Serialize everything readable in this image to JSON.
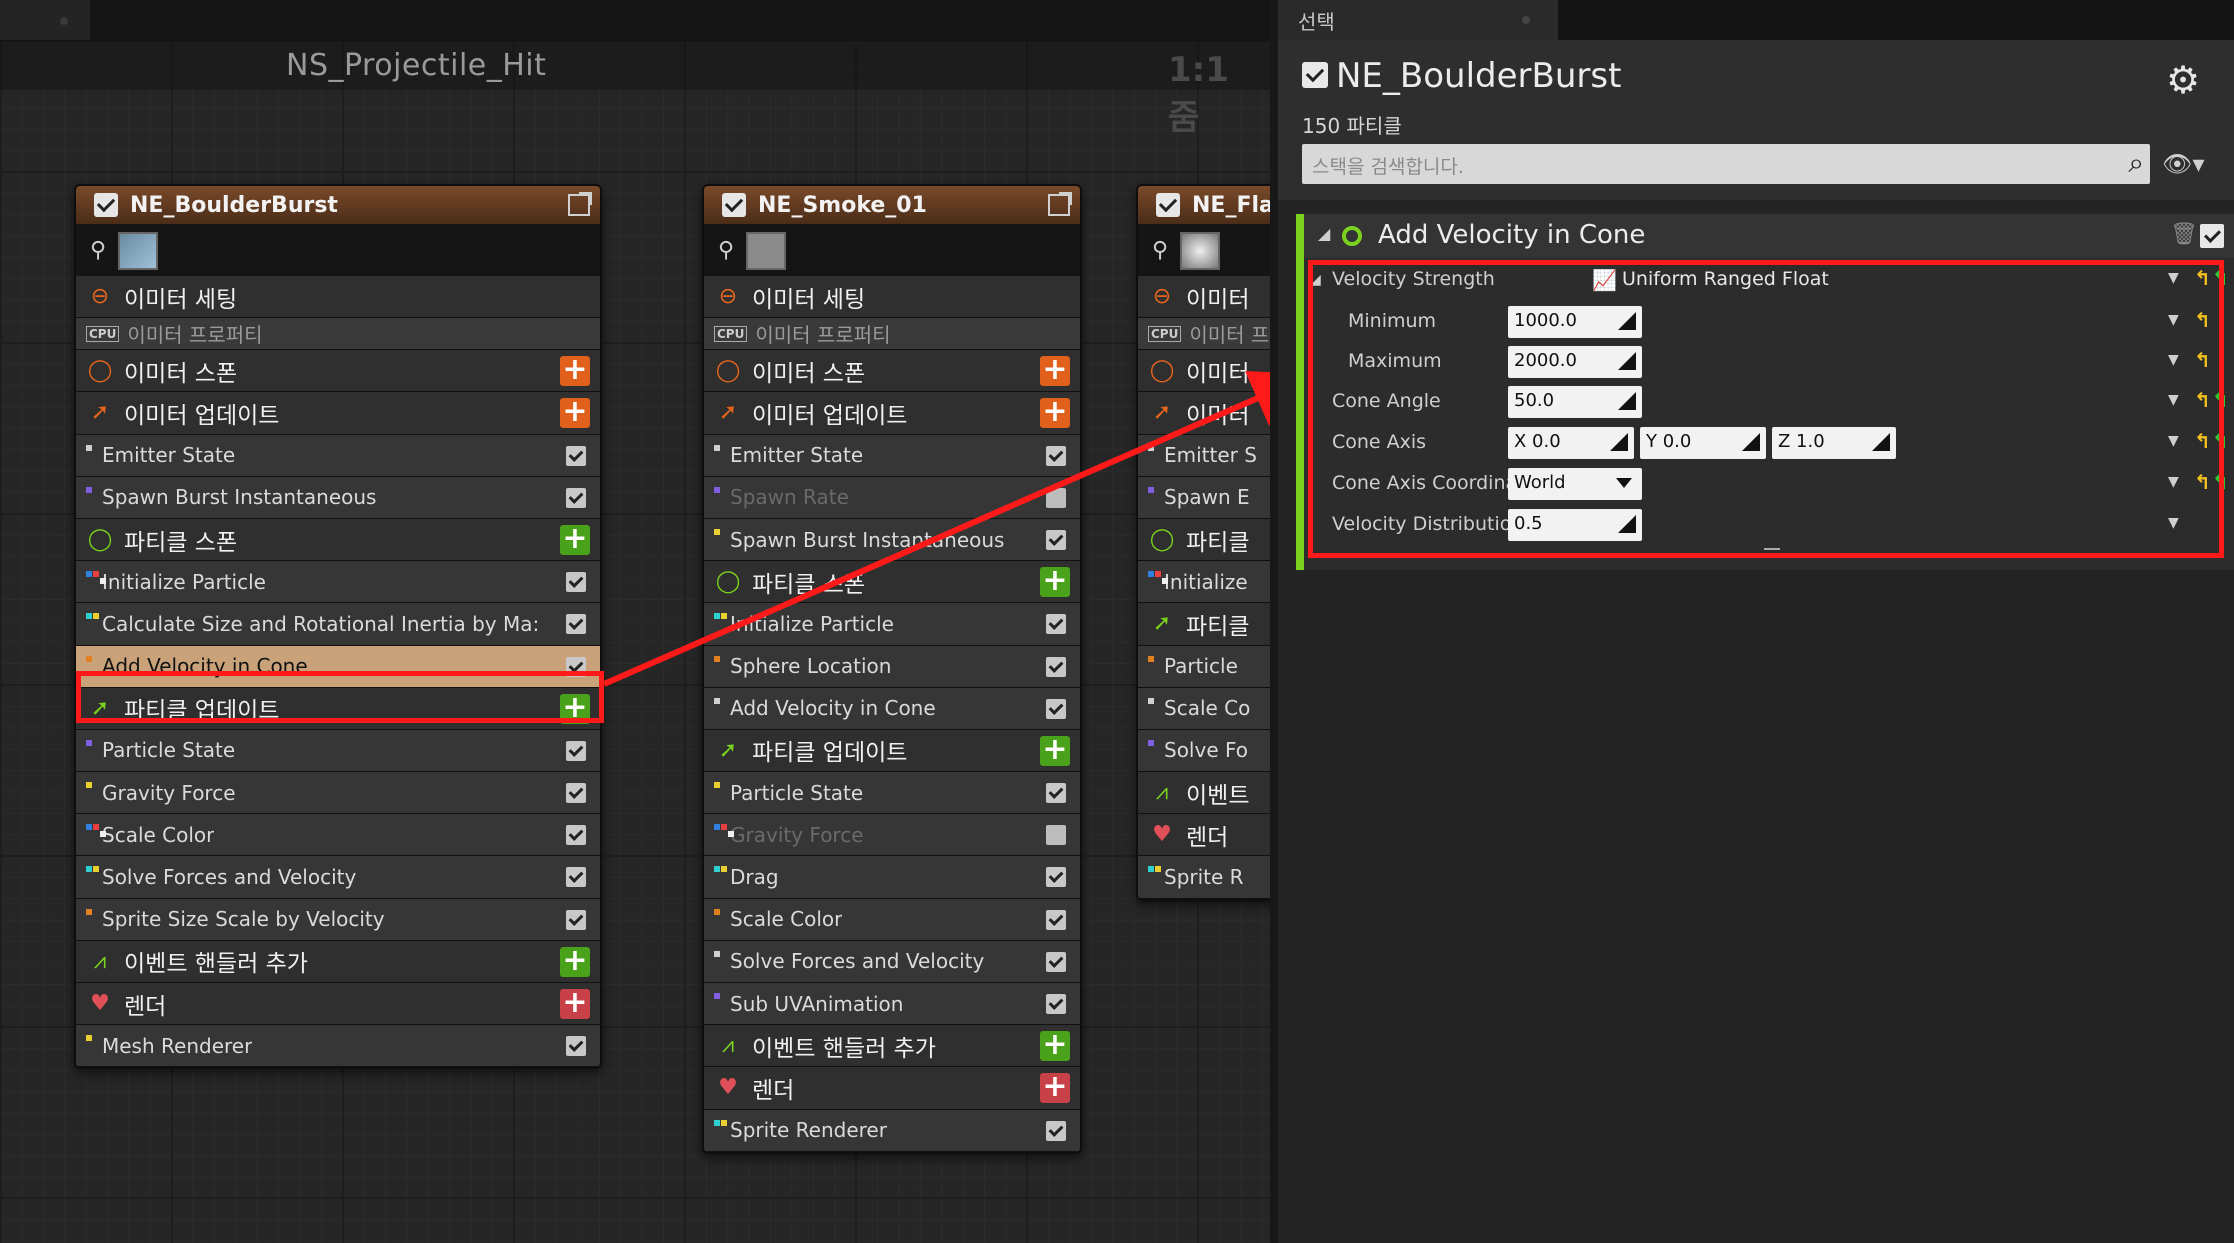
{
  "graph": {
    "title": "NS_Projectile_Hit",
    "zoom": "1:1 줌"
  },
  "nodes": [
    {
      "name": "NE_BoulderBurst",
      "rows": [
        {
          "kind": "stage",
          "label": "이미터 세팅",
          "icon": "emitter-settings-icon"
        },
        {
          "kind": "cpu",
          "label": "이미터 프로퍼티",
          "badge": "CPU"
        },
        {
          "kind": "stage",
          "label": "이미터 스폰",
          "icon": "emitter-spawn-icon",
          "add": "orange"
        },
        {
          "kind": "stage",
          "label": "이미터 업데이트",
          "icon": "emitter-update-icon",
          "add": "orange"
        },
        {
          "kind": "module",
          "label": "Emitter State",
          "on": true
        },
        {
          "kind": "module",
          "label": "Spawn Burst Instantaneous",
          "on": true
        },
        {
          "kind": "stage",
          "label": "파티클 스폰",
          "icon": "particle-spawn-icon",
          "add": "green"
        },
        {
          "kind": "module",
          "label": "Initialize Particle",
          "on": true
        },
        {
          "kind": "module",
          "label": "Calculate Size and Rotational Inertia by Ma:",
          "on": true
        },
        {
          "kind": "module",
          "label": "Add Velocity in Cone",
          "on": true,
          "selected": true
        },
        {
          "kind": "stage",
          "label": "파티클 업데이트",
          "icon": "particle-update-icon",
          "add": "green"
        },
        {
          "kind": "module",
          "label": "Particle State",
          "on": true
        },
        {
          "kind": "module",
          "label": "Gravity Force",
          "on": true
        },
        {
          "kind": "module",
          "label": "Scale Color",
          "on": true
        },
        {
          "kind": "module",
          "label": "Solve Forces and Velocity",
          "on": true
        },
        {
          "kind": "module",
          "label": "Sprite Size Scale by Velocity",
          "on": true
        },
        {
          "kind": "stage",
          "label": "이벤트 핸들러 추가",
          "icon": "event-handler-icon",
          "add": "green"
        },
        {
          "kind": "stage",
          "label": "렌더",
          "icon": "render-icon",
          "add": "red"
        },
        {
          "kind": "module",
          "label": "Mesh Renderer",
          "on": true
        }
      ]
    },
    {
      "name": "NE_Smoke_01",
      "rows": [
        {
          "kind": "stage",
          "label": "이미터 세팅",
          "icon": "emitter-settings-icon"
        },
        {
          "kind": "cpu",
          "label": "이미터 프로퍼티",
          "badge": "CPU"
        },
        {
          "kind": "stage",
          "label": "이미터 스폰",
          "icon": "emitter-spawn-icon",
          "add": "orange"
        },
        {
          "kind": "stage",
          "label": "이미터 업데이트",
          "icon": "emitter-update-icon",
          "add": "orange"
        },
        {
          "kind": "module",
          "label": "Emitter State",
          "on": true
        },
        {
          "kind": "module",
          "label": "Spawn Rate",
          "on": false
        },
        {
          "kind": "module",
          "label": "Spawn Burst Instantaneous",
          "on": true
        },
        {
          "kind": "stage",
          "label": "파티클 스폰",
          "icon": "particle-spawn-icon",
          "add": "green"
        },
        {
          "kind": "module",
          "label": "Initialize Particle",
          "on": true
        },
        {
          "kind": "module",
          "label": "Sphere Location",
          "on": true
        },
        {
          "kind": "module",
          "label": "Add Velocity in Cone",
          "on": true
        },
        {
          "kind": "stage",
          "label": "파티클 업데이트",
          "icon": "particle-update-icon",
          "add": "green"
        },
        {
          "kind": "module",
          "label": "Particle State",
          "on": true
        },
        {
          "kind": "module",
          "label": "Gravity Force",
          "on": false
        },
        {
          "kind": "module",
          "label": "Drag",
          "on": true
        },
        {
          "kind": "module",
          "label": "Scale Color",
          "on": true
        },
        {
          "kind": "module",
          "label": "Solve Forces and Velocity",
          "on": true
        },
        {
          "kind": "module",
          "label": "Sub UVAnimation",
          "on": true
        },
        {
          "kind": "stage",
          "label": "이벤트 핸들러 추가",
          "icon": "event-handler-icon",
          "add": "green"
        },
        {
          "kind": "stage",
          "label": "렌더",
          "icon": "render-icon",
          "add": "red"
        },
        {
          "kind": "module",
          "label": "Sprite Renderer",
          "on": true
        }
      ]
    },
    {
      "name": "NE_Fla",
      "rows": [
        {
          "kind": "stage",
          "label": "이미터 ",
          "icon": "emitter-settings-icon"
        },
        {
          "kind": "cpu",
          "label": "이미터 프",
          "badge": "CPU"
        },
        {
          "kind": "stage",
          "label": "이미터 ",
          "icon": "emitter-spawn-icon"
        },
        {
          "kind": "stage",
          "label": "이미터 ",
          "icon": "emitter-update-icon"
        },
        {
          "kind": "module",
          "label": "Emitter S"
        },
        {
          "kind": "module",
          "label": "Spawn E"
        },
        {
          "kind": "stage",
          "label": "파티클 ",
          "icon": "particle-spawn-icon"
        },
        {
          "kind": "module",
          "label": "Initialize"
        },
        {
          "kind": "stage",
          "label": "파티클 ",
          "icon": "particle-update-icon"
        },
        {
          "kind": "module",
          "label": "Particle "
        },
        {
          "kind": "module",
          "label": "Scale Co"
        },
        {
          "kind": "module",
          "label": "Solve Fo"
        },
        {
          "kind": "stage",
          "label": "이벤트 ",
          "icon": "event-handler-icon"
        },
        {
          "kind": "stage",
          "label": "렌더",
          "icon": "render-icon"
        },
        {
          "kind": "module",
          "label": "Sprite R"
        }
      ]
    }
  ],
  "details": {
    "tab_label": "선택",
    "emitter_name": "NE_BoulderBurst",
    "particle_count": "150 파티클",
    "search_placeholder": "스택을 검색합니다.",
    "module": {
      "title": "Add Velocity in Cone",
      "velocity_strength_label": "Velocity Strength",
      "distribution": "Uniform Ranged Float",
      "minimum_label": "Minimum",
      "minimum_value": "1000.0",
      "maximum_label": "Maximum",
      "maximum_value": "2000.0",
      "cone_angle_label": "Cone Angle",
      "cone_angle_value": "50.0",
      "cone_axis_label": "Cone Axis",
      "cone_axis_x": "X  0.0",
      "cone_axis_y": "Y  0.0",
      "cone_axis_z": "Z  1.0",
      "coord_space_label": "Cone Axis Coordinate Spac",
      "coord_space_value": "World",
      "dist_along_label": "Velocity Distribution Along",
      "dist_along_value": "0.5"
    }
  },
  "colors": {
    "highlight": "#ff1a1a",
    "selected_row": "#c9a27a",
    "stage_orange": "#e0601c",
    "stage_green": "#4aa21a",
    "stage_red": "#c84048"
  }
}
